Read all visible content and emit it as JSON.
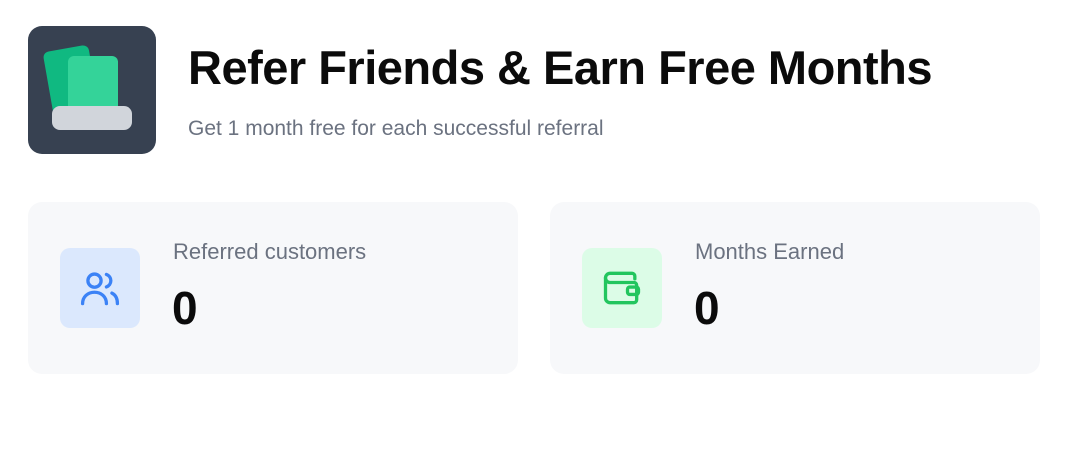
{
  "header": {
    "logo_icon": "referral-cards-icon",
    "title": "Refer Friends & Earn Free Months",
    "subtitle": "Get 1 month free for each successful referral"
  },
  "stats": [
    {
      "label": "Referred customers",
      "value": "0",
      "icon": "users-icon",
      "accent": "#3b82f6",
      "icon_bg": "#dbe8fd"
    },
    {
      "label": "Months Earned",
      "value": "0",
      "icon": "wallet-icon",
      "accent": "#22c55e",
      "icon_bg": "#dcfce7"
    }
  ],
  "colors": {
    "logo_bg": "#374151",
    "card_bg": "#f7f8fa",
    "muted_text": "#6b7280"
  }
}
